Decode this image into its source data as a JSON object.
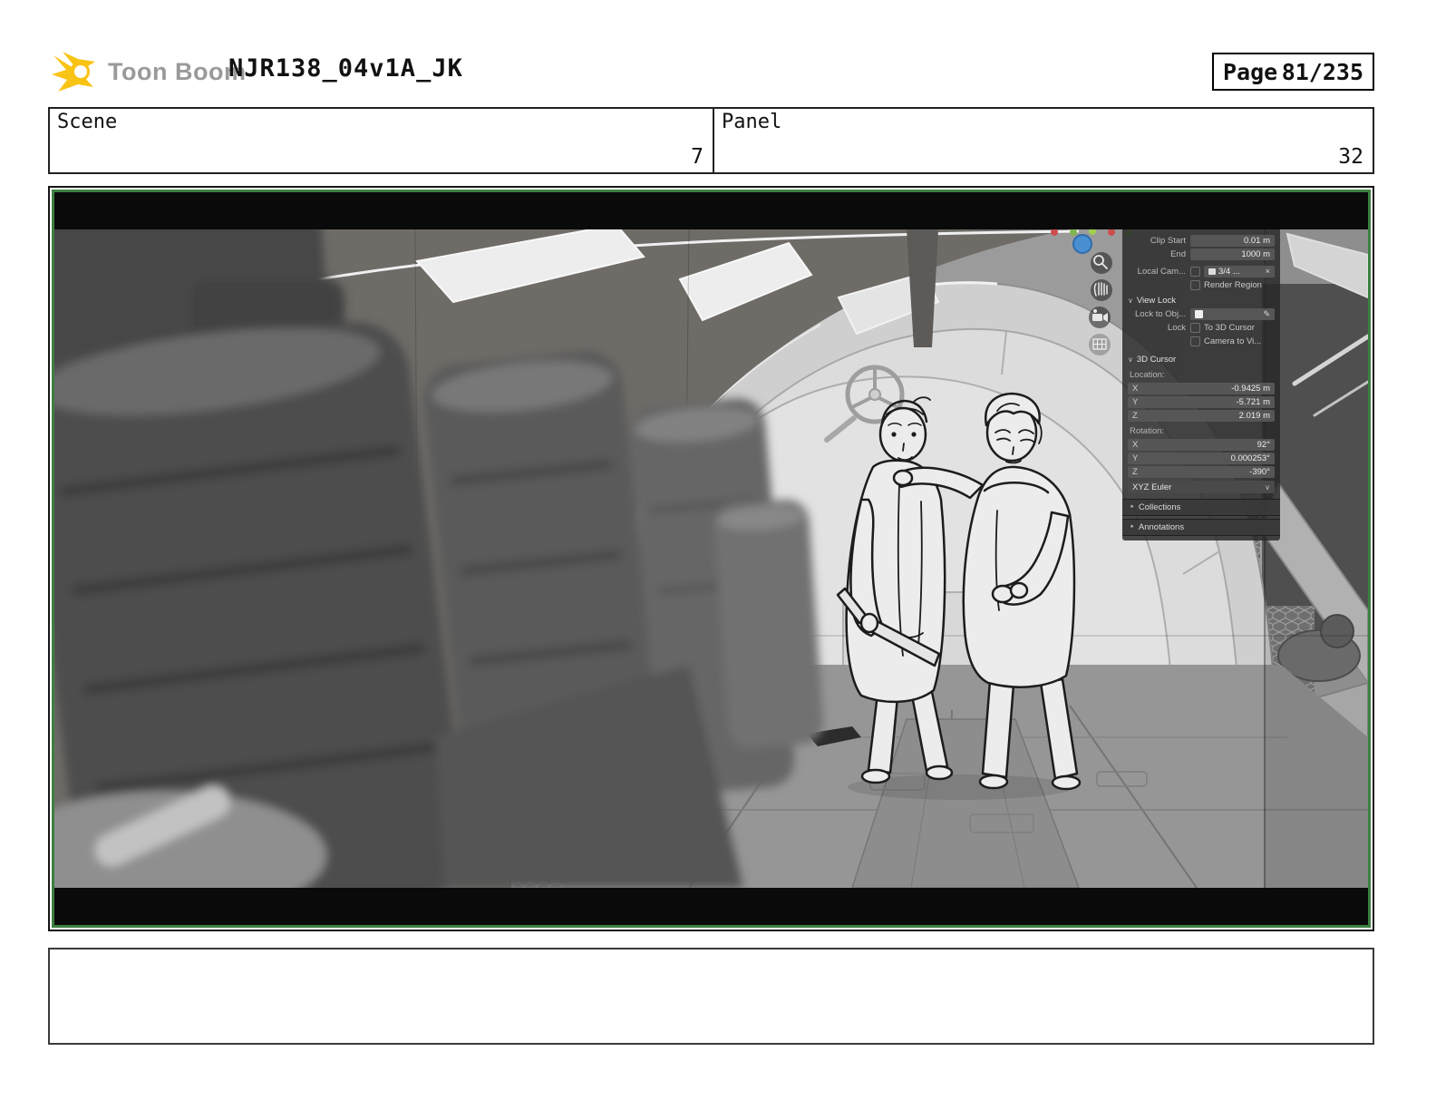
{
  "header": {
    "logo_text": "Toon Boom",
    "title": "NJR138_04v1A_JK",
    "page_label": "Page",
    "page_number": "81/235"
  },
  "info_row": {
    "scene_label": "Scene",
    "scene_number": "7",
    "panel_label": "Panel",
    "panel_number": "32"
  },
  "caption_text": "",
  "viewport_panel": {
    "clip_start_label": "Clip Start",
    "clip_start_value": "0.01 m",
    "end_label": "End",
    "end_value": "1000 m",
    "local_camera_label": "Local Cam...",
    "local_camera_value": "3/4 ...",
    "local_camera_clear": "×",
    "render_region_label": "Render Region",
    "view_lock_header": "View Lock",
    "lock_to_object_label": "Lock to Obj...",
    "lock_label": "Lock",
    "to_3d_cursor_label": "To 3D Cursor",
    "camera_to_view_label": "Camera to Vi...",
    "cursor_header": "3D Cursor",
    "location_label": "Location:",
    "location": [
      {
        "axis": "X",
        "value": "-0.9425 m"
      },
      {
        "axis": "Y",
        "value": "-5.721 m"
      },
      {
        "axis": "Z",
        "value": "2.019 m"
      }
    ],
    "rotation_label": "Rotation:",
    "rotation": [
      {
        "axis": "X",
        "value": "92°"
      },
      {
        "axis": "Y",
        "value": "0.000253°"
      },
      {
        "axis": "Z",
        "value": "-390°"
      }
    ],
    "euler_mode": "XYZ Euler",
    "collections_header": "Collections",
    "annotations_header": "Annotations"
  },
  "colors": {
    "accent_green": "#3c8040",
    "logo_yellow": "#F9C313",
    "panel_bg": "#282828",
    "letterbox": "#0a0a0a"
  }
}
